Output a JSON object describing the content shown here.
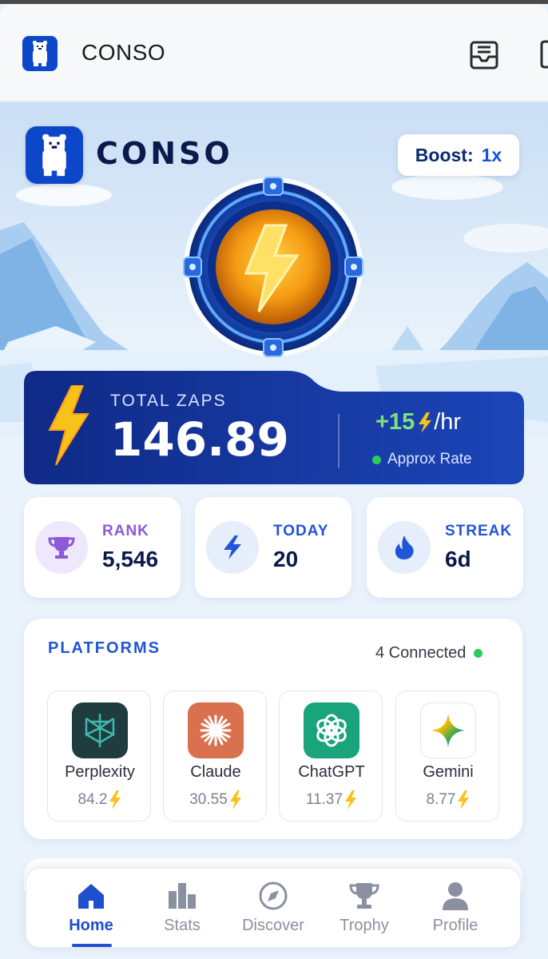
{
  "appbar": {
    "title": "CONSO",
    "icons": [
      "polar-bear-logo",
      "inbox-icon",
      "window-icon"
    ]
  },
  "hero": {
    "brand_name": "CONSO",
    "boost_label": "Boost:",
    "boost_value": "1x"
  },
  "zaps": {
    "label": "TOTAL ZAPS",
    "value": "146.89",
    "rate_value": "+15",
    "rate_unit": "/hr",
    "rate_caption": "Approx Rate",
    "status_color": "#2ecb5b"
  },
  "stats": [
    {
      "label": "RANK",
      "value": "5,546",
      "icon": "trophy-icon",
      "color": "#8a5ad8"
    },
    {
      "label": "TODAY",
      "value": "20",
      "icon": "bolt-icon",
      "color": "#1f55d6"
    },
    {
      "label": "STREAK",
      "value": "6d",
      "icon": "flame-icon",
      "color": "#1f55d6"
    }
  ],
  "platforms": {
    "title": "PLATFORMS",
    "connected": "4 Connected",
    "items": [
      {
        "name": "Perplexity",
        "score": "84.2",
        "icon": "perplexity-logo"
      },
      {
        "name": "Claude",
        "score": "30.55",
        "icon": "claude-logo"
      },
      {
        "name": "ChatGPT",
        "score": "11.37",
        "icon": "chatgpt-logo"
      },
      {
        "name": "Gemini",
        "score": "8.77",
        "icon": "gemini-logo"
      }
    ]
  },
  "nav": {
    "items": [
      {
        "label": "Home",
        "icon": "home-icon",
        "active": true
      },
      {
        "label": "Stats",
        "icon": "stats-icon",
        "active": false
      },
      {
        "label": "Discover",
        "icon": "compass-icon",
        "active": false
      },
      {
        "label": "Trophy",
        "icon": "trophy-icon",
        "active": false
      },
      {
        "label": "Profile",
        "icon": "profile-icon",
        "active": false
      }
    ]
  },
  "colors": {
    "accent": "#1f4fcf",
    "card_dark": "#13318f",
    "zap_yellow": "#f7c21a"
  }
}
